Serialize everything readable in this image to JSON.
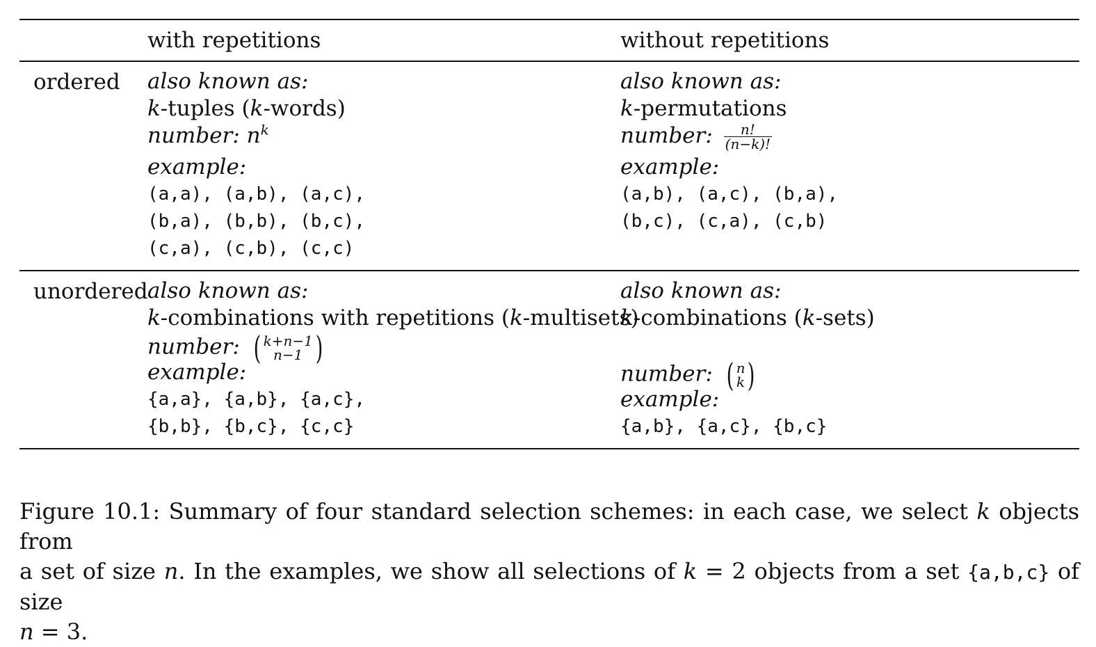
{
  "table": {
    "headers": [
      "with repetitions",
      "without repetitions"
    ],
    "rows": [
      {
        "label": "ordered",
        "with": {
          "aka_label": "also known as:",
          "name": "k-tuples (k-words)",
          "number_label": "number:",
          "number_formula": "n^k",
          "example_label": "example:",
          "examples": [
            "(a,a), (a,b), (a,c),",
            "(b,a), (b,b), (b,c),",
            "(c,a), (c,b), (c,c)"
          ]
        },
        "without": {
          "aka_label": "also known as:",
          "name": "k-permutations",
          "number_label": "number:",
          "number_formula": "n!/(n−k)!",
          "example_label": "example:",
          "examples": [
            "(a,b), (a,c), (b,a),",
            "(b,c), (c,a), (c,b)"
          ]
        }
      },
      {
        "label": "unordered",
        "with": {
          "aka_label": "also known as:",
          "name": "k-combinations with repetitions (k-multisets)",
          "number_label": "number:",
          "number_formula": "(k+n−1 choose n−1)",
          "example_label": "example:",
          "examples": [
            "{a,a}, {a,b}, {a,c},",
            "{b,b}, {b,c}, {c,c}"
          ]
        },
        "without": {
          "aka_label": "also known as:",
          "name": "k-combinations (k-sets)",
          "number_label": "number:",
          "number_formula": "(n choose k)",
          "example_label": "example:",
          "examples": [
            "{a,b}, {a,c}, {b,c}"
          ]
        }
      }
    ]
  },
  "caption": {
    "label": "Figure 10.1:",
    "text": "Summary of four standard selection schemes: in each case, we select k objects from a set of size n. In the examples, we show all selections of k = 2 objects from a set {a,b,c} of size n = 3."
  }
}
